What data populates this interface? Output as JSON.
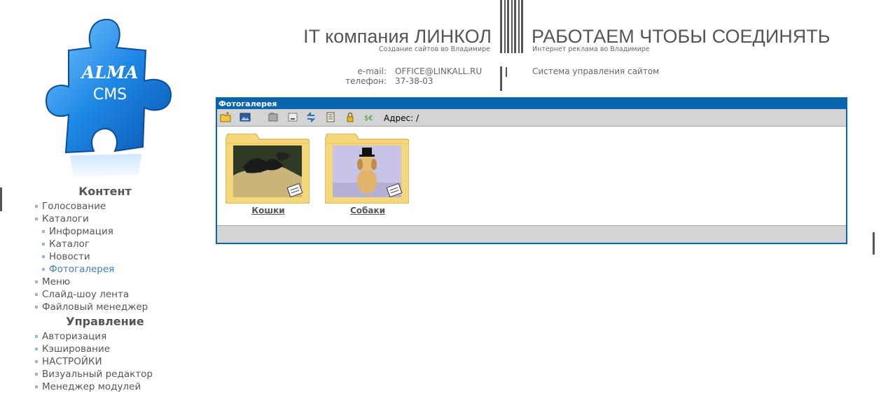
{
  "logo": {
    "line1": "ALMA",
    "line2": "CMS",
    "color": "#1e88e5"
  },
  "header": {
    "left_title": "IT компания ЛИНКОЛ",
    "left_subtitle": "Создание сайтов во Владимире",
    "right_title": "РАБОТАЕМ ЧТОБЫ СОЕДИНЯТЬ",
    "right_subtitle": "Интернет реклама во Владимире",
    "email_label": "e-mail:",
    "email_value": "OFFICE@LINKALL.RU",
    "phone_label": "телефон:",
    "phone_value": "37-38-03",
    "cms_link": "Система управления сайтом"
  },
  "sidebar": {
    "content_heading": "Контент",
    "content_items": [
      {
        "label": "Голосование",
        "sub": false,
        "active": false
      },
      {
        "label": "Каталоги",
        "sub": false,
        "active": false
      },
      {
        "label": "Информация",
        "sub": true,
        "active": false
      },
      {
        "label": "Каталог",
        "sub": true,
        "active": false
      },
      {
        "label": "Новости",
        "sub": true,
        "active": false
      },
      {
        "label": "Фотогалерея",
        "sub": true,
        "active": true
      },
      {
        "label": "Меню",
        "sub": false,
        "active": false
      },
      {
        "label": "Слайд-шоу лента",
        "sub": false,
        "active": false
      },
      {
        "label": "Файловый менеджер",
        "sub": false,
        "active": false
      }
    ],
    "manage_heading": "Управление",
    "manage_items": [
      {
        "label": "Авторизация"
      },
      {
        "label": "Кэширование"
      },
      {
        "label": "НАСТРОЙКИ"
      },
      {
        "label": "Визуальный редактор"
      },
      {
        "label": "Менеджер модулей"
      }
    ]
  },
  "gallery": {
    "title": "Фотогалерея",
    "address_label": "Адрес: /",
    "toolbar_icons": [
      "new-folder-icon",
      "add-image-icon",
      "folder-icon",
      "rename-icon",
      "refresh-icon",
      "properties-icon",
      "lock-icon",
      "currency-icon"
    ],
    "folders": [
      {
        "label": "Кошки",
        "icon": "cats-folder-icon"
      },
      {
        "label": "Собаки",
        "icon": "dogs-folder-icon"
      }
    ],
    "accent_color": "#0a64ad",
    "toolbar_color": "#d4d4d4"
  }
}
